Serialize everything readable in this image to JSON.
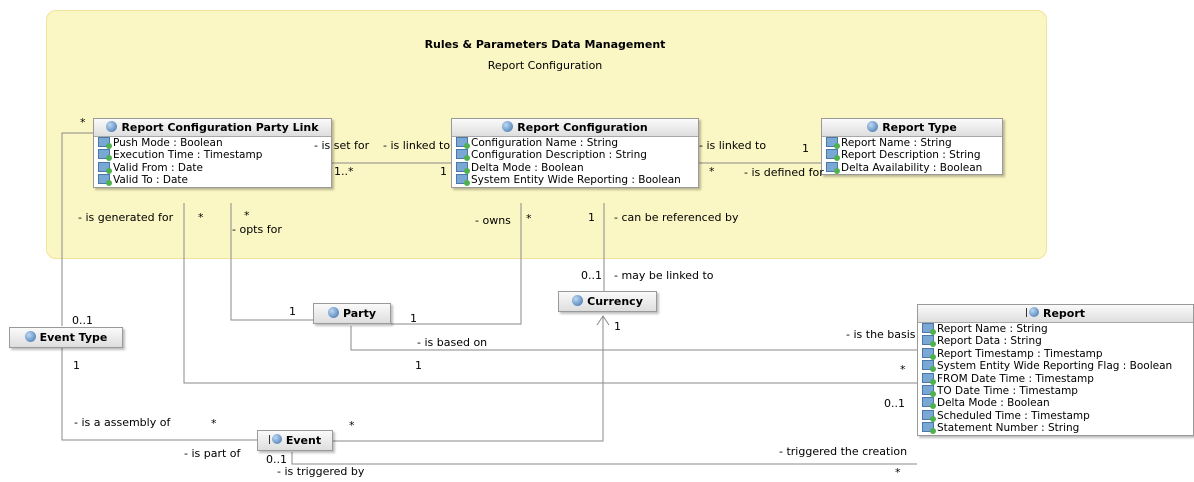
{
  "package": {
    "title": "Rules & Parameters Data Management",
    "subtitle": "Report Configuration"
  },
  "classes": {
    "rcpl": {
      "name": "Report Configuration Party Link",
      "attrs": [
        "Push Mode : Boolean",
        "Execution Time : Timestamp",
        "Valid From : Date",
        "Valid To : Date"
      ]
    },
    "rc": {
      "name": "Report Configuration",
      "attrs": [
        "Configuration Name : String",
        "Configuration Description : String",
        "Delta Mode : Boolean",
        "System Entity Wide Reporting : Boolean"
      ]
    },
    "rt": {
      "name": "Report Type",
      "attrs": [
        "Report Name : String",
        "Report Description : String",
        "Delta Availability : Boolean"
      ]
    },
    "party": {
      "name": "Party"
    },
    "currency": {
      "name": "Currency"
    },
    "eventtype": {
      "name": "Event Type"
    },
    "event": {
      "name": "Event"
    },
    "report": {
      "name": "Report",
      "attrs": [
        "Report Name : String",
        "Report Data : String",
        "Report Timestamp : Timestamp",
        "System Entity Wide Reporting Flag : Boolean",
        "FROM Date Time : Timestamp",
        "TO Date Time : Timestamp",
        "Delta Mode : Boolean",
        "Scheduled Time : Timestamp",
        "Statement Number : String"
      ]
    }
  },
  "labels": {
    "star_rcpl_top": "*",
    "is_set_for": "- is set for",
    "is_linked_to_a": "- is linked to",
    "one_star": "1..*",
    "one_rc_left": "1",
    "is_linked_to_b": "- is linked to",
    "one_rt": "1",
    "star_rc_right": "*",
    "is_defined_for": "- is defined for",
    "is_generated_for": "- is generated for",
    "star_a": "*",
    "star_b": "*",
    "opts_for": "- opts for",
    "owns": "- owns",
    "star_owns": "*",
    "one_cref": "1",
    "can_be_referenced_by": "- can be referenced by",
    "zero_one_cur": "0..1",
    "may_be_linked_to": "- may be linked to",
    "zero_one_et": "0..1",
    "one_party_l": "1",
    "one_party_r": "1",
    "one_cur": "1",
    "is_based_on": "- is based on",
    "is_the_basis": "- is the basis",
    "one_et": "1",
    "one_mid": "1",
    "star_rep": "*",
    "zero_one_rep": "0..1",
    "is_a_assembly_of": "- is a assembly of",
    "star_ev_l": "*",
    "star_ev_r": "*",
    "triggered_the_creation": "- triggered the creation",
    "is_part_of": "- is part of",
    "zero_one_ev": "0..1",
    "is_triggered_by": "- is triggered by",
    "star_rep_bottom": "*"
  }
}
